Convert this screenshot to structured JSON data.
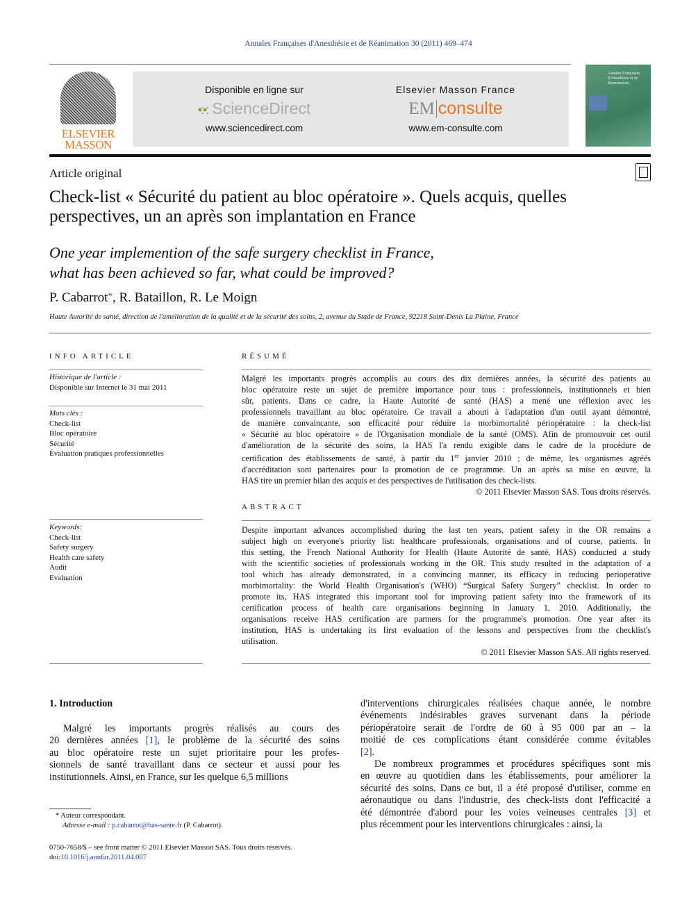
{
  "journal_ref": "Annales Françaises d'Anesthésie et de Réanimation 30 (2011) 469–474",
  "banner": {
    "publisher_logo": "ELSEVIER MASSON",
    "left": {
      "heading": "Disponible en ligne sur",
      "brand": "ScienceDirect",
      "url": "www.sciencedirect.com"
    },
    "right": {
      "heading": "Elsevier Masson France",
      "brand_em": "EM",
      "brand_consulte": "consulte",
      "url": "www.em-consulte.com"
    },
    "cover_title": "Annales Françaises d'Anesthésie et de Réanimation"
  },
  "article_type": "Article original",
  "title_lines": [
    "Check-list « Sécurité du patient au bloc opératoire ». Quels acquis, quelles",
    "perspectives, un an après son implantation en France"
  ],
  "english_title_lines": [
    "One year implemention of the safe surgery checklist in France,",
    "what has been achieved so far, what could be improved?"
  ],
  "authors": {
    "first": "P. Cabarrot",
    "star": "*",
    "rest": ", R. Bataillon, R. Le Moign"
  },
  "affiliation": "Haute Autorité de santé, direction de l'amélioration de la qualité et de la sécurité des soins, 2, avenue du Stade de France, 92218 Saint-Denis La Plaine, France",
  "info": {
    "heading": "INFO ARTICLE",
    "history_label": "Historique de l'article :",
    "history_value": "Disponible sur Internet le 31 mai 2011",
    "motscles_label": "Mots clés :",
    "motscles": [
      "Check-list",
      "Bloc opératoire",
      "Sécurité",
      "Évaluation pratiques professionnelles"
    ],
    "keywords_label": "Keywords:",
    "keywords": [
      "Check-list",
      "Safety surgery",
      "Health care safety",
      "Audit",
      "Evaluation"
    ]
  },
  "resume": {
    "heading": "RÉSUMÉ",
    "lines": [
      [
        "Malgré les importants progrès accomplis au cours des dix dernières années, la sécurité des patients au"
      ],
      [
        "bloc opératoire reste un sujet de première importance pour tous : professionnels, institutionnels et bien"
      ],
      [
        "sûr, patients. Dans ce cadre, la Haute Autorité de santé (HAS) a mené une réflexion avec les"
      ],
      [
        "professionnels travaillant au bloc opératoire. Ce travail a abouti à l'adaptation d'un outil ayant démontré,"
      ],
      [
        "de manière convaincante, son efficacité pour réduire la morbimortalité périopératoire : la check-list"
      ],
      [
        "« Sécurité au bloc opératoire » de l'Organisation mondiale de la santé (OMS). Afin de promouvoir cet outil"
      ],
      [
        "d'amélioration de la sécurité des soins, la HAS l'a rendu exigible dans le cadre de la procédure de"
      ],
      [
        "certification des établissements de santé, à partir du 1",
        {
          "sup": "er"
        },
        " janvier 2010 ; de même, les organismes agréés"
      ],
      [
        "d'accréditation sont partenaires pour la promotion de ce programme. Un an après sa mise en œuvre, la"
      ],
      [
        "HAS tire un premier bilan des acquis et des perspectives de l'utilisation des check-lists."
      ]
    ],
    "copyright": "© 2011 Elsevier Masson SAS. Tous droits réservés."
  },
  "abstract": {
    "heading": "ABSTRACT",
    "lines": [
      [
        "Despite important advances accomplished during the last ten years, patient safety in the OR remains a"
      ],
      [
        "subject high on everyone's priority list: healthcare professionals, organisations and of course, patients. In"
      ],
      [
        "this setting, the French National Authority for Health (Haute Autorité de santé, HAS) conducted a study"
      ],
      [
        "with the scientific societies of professionals working in the OR. This study resulted in the adaptation of a"
      ],
      [
        "tool which has already demonstrated, in a convincing manner, its efficacy in reducing perioperative"
      ],
      [
        "morbimortality: the World Health Organisation's (WHO) “Surgical Safety Surgery” checklist. In order to"
      ],
      [
        "promote its, HAS integrated this important tool for improving patient safety into the framework of its"
      ],
      [
        "certification process of health care organisations beginning in January 1, 2010. Additionally, the"
      ],
      [
        "organisations receive HAS certification are partners for the programme's promotion. One year after its"
      ],
      [
        "institution, HAS is undertaking its first evaluation of the lessons and perspectives from the checklist's"
      ],
      [
        "utilisation."
      ]
    ],
    "copyright": "© 2011 Elsevier Masson SAS. All rights reserved."
  },
  "body": {
    "section_heading": "1. Introduction",
    "col1": [
      [
        "Malgré les importants progrès réalisés au cours des"
      ],
      [
        "20 dernières années ",
        {
          "ref": "[1]"
        },
        ", le problème de la sécurité des soins"
      ],
      [
        "au bloc opératoire reste un sujet prioritaire pour les profes-"
      ],
      [
        "sionnels de santé travaillant dans ce secteur et aussi pour les"
      ],
      [
        "institutionnels. Ainsi, en France, sur les quelque 6,5 millions"
      ]
    ],
    "col2": [
      [
        "d'interventions chirurgicales réalisées chaque année, le nombre"
      ],
      [
        "événements indésirables graves survenant dans la période"
      ],
      [
        "périopératoire serait de l'ordre de 60 à 95 000 par an – la"
      ],
      [
        "moitié de ces complications étant considérée comme évitables"
      ],
      [
        {
          "ref": "[2]"
        },
        "."
      ],
      [
        "De nombreux programmes et procédures spécifiques sont mis"
      ],
      [
        "en œuvre au quotidien dans les établissements, pour améliorer la"
      ],
      [
        "sécurité des soins. Dans ce but, il a été proposé d'utiliser, comme en"
      ],
      [
        "aéronautique ou dans l'industrie, des check-lists dont l'efficacité a"
      ],
      [
        "été démontrée d'abord pour les voies veineuses centrales ",
        {
          "ref": "[3]"
        },
        " et"
      ],
      [
        "plus récemment pour les interventions chirurgicales : ainsi, la"
      ]
    ]
  },
  "footnote": {
    "star": "*",
    "text": "Auteur correspondant.",
    "email_label": "Adresse e-mail :",
    "email": "p.cabarrot@has-sante.fr",
    "email_suffix": "(P. Cabarrot)."
  },
  "front_matter": "0750-7658/$ – see front matter © 2011 Elsevier Masson SAS. Tous droits réservés.",
  "doi_label": "doi:",
  "doi": "10.1016/j.annfar.2011.04.007",
  "colors": {
    "link": "#1f3fa0",
    "elsevier_orange": "#e87722",
    "sciencedirect_green": "#7ea33a"
  }
}
